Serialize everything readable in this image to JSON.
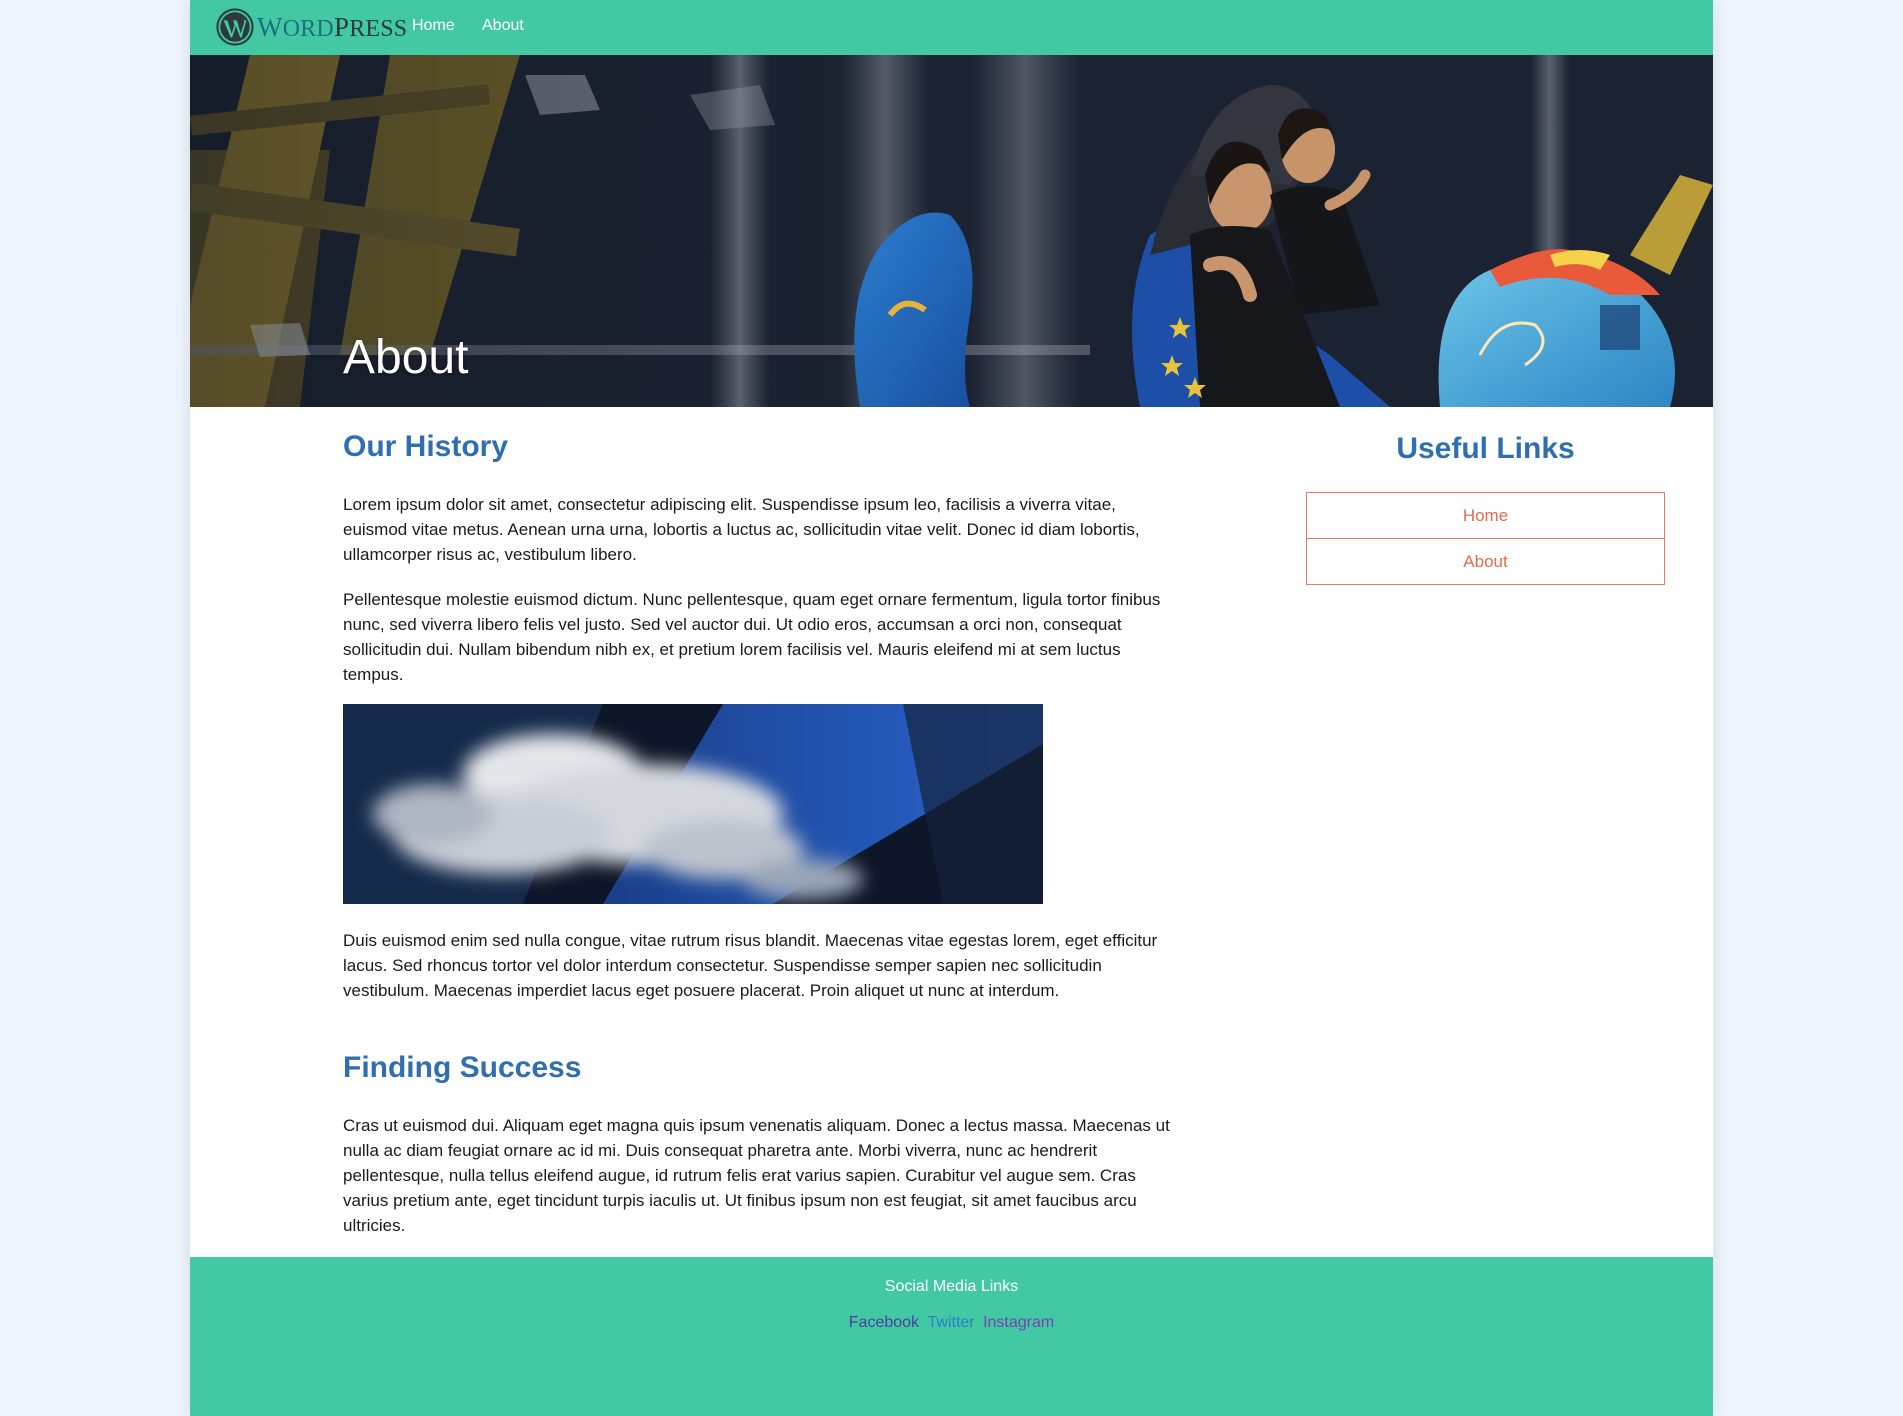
{
  "nav": {
    "logo_text_w": "W",
    "logo_text_ord": "ORD",
    "logo_text_p": "P",
    "logo_text_ress": "RESS",
    "links": [
      {
        "label": "Home"
      },
      {
        "label": "About"
      }
    ]
  },
  "hero": {
    "title": "About"
  },
  "main": {
    "sections": [
      {
        "heading": "Our History"
      },
      {
        "heading": "Finding Success"
      }
    ],
    "paragraphs": [
      "Lorem ipsum dolor sit amet, consectetur adipiscing elit. Suspendisse ipsum leo, facilisis a viverra vitae, euismod vitae metus. Aenean urna urna, lobortis a luctus ac, sollicitudin vitae velit. Donec id diam lobortis, ullamcorper risus ac, vestibulum libero.",
      "Pellentesque molestie euismod dictum. Nunc pellentesque, quam eget ornare fermentum, ligula tortor finibus nunc, sed viverra libero felis vel justo. Sed vel auctor dui. Ut odio eros, accumsan a orci non, consequat sollicitudin dui. Nullam bibendum nibh ex, et pretium lorem facilisis vel. Mauris eleifend mi at sem luctus tempus.",
      "Duis euismod enim sed nulla congue, vitae rutrum risus blandit. Maecenas vitae egestas lorem, eget efficitur lacus. Sed rhoncus tortor vel dolor interdum consectetur. Suspendisse semper sapien nec sollicitudin vestibulum. Maecenas imperdiet lacus eget posuere placerat. Proin aliquet ut nunc at interdum.",
      "Cras ut euismod dui. Aliquam eget magna quis ipsum venenatis aliquam. Donec a lectus massa. Maecenas ut nulla ac diam feugiat ornare ac id mi. Duis consequat pharetra ante. Morbi viverra, nunc ac hendrerit pellentesque, nulla tellus eleifend augue, id rutrum felis erat varius sapien. Curabitur vel augue sem. Cras varius pretium ante, eget tincidunt turpis iaculis ut. Ut finibus ipsum non est feugiat, sit amet faucibus arcu ultricies."
    ]
  },
  "sidebar": {
    "title": "Useful Links",
    "links": [
      {
        "label": "Home"
      },
      {
        "label": "About"
      }
    ]
  },
  "footer": {
    "title": "Social Media Links",
    "links": [
      {
        "label": "Facebook",
        "color": "#4a3fa0"
      },
      {
        "label": "Twitter",
        "color": "#2a7fc9"
      },
      {
        "label": "Instagram",
        "color": "#7a3fb0"
      }
    ]
  },
  "colors": {
    "accent": "#42c9a4",
    "heading": "#2f6eb0",
    "sidebar_link": "#e56a4c"
  }
}
